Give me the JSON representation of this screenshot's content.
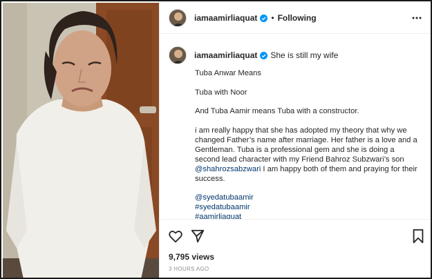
{
  "post": {
    "username": "iamaamirliaquat",
    "follow_status": "Following",
    "separator": "•",
    "caption_first_line": "She is still my wife",
    "paragraphs": [
      "Tuba Anwar Means",
      "Tuba with Noor",
      "And Tuba Aamir means Tuba with a constructor.",
      "i am really happy that she has adopted my theory that why we changed Father’s name after marriage. Her father is a love and a Gentleman. Tuba is a professional gem and she is doing a second lead character with my Friend Bahroz Subzwari’s son"
    ],
    "mention": "@shahrozsabzwari",
    "after_mention": " I am happy both of them and praying for their success.",
    "tags": [
      "@syedatubaamir",
      "#syedatubaamir",
      "#aamirliaquat"
    ],
    "views": "9,795 views",
    "timestamp": "3 HOURS AGO"
  },
  "colors": {
    "verified": "#0095f6",
    "link": "#00376b",
    "muted": "#8e8e8e",
    "door": "#8a4a25"
  },
  "icons": [
    "verified-badge-icon",
    "more-options-icon",
    "heart-icon",
    "share-icon",
    "bookmark-icon"
  ]
}
